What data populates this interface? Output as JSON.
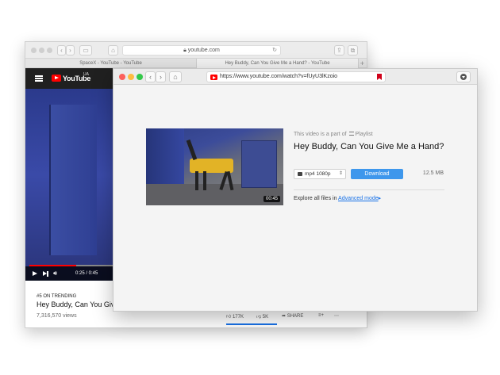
{
  "back_browser": {
    "url": "youtube.com",
    "tabs": [
      {
        "label": "SpaceX - YouTube - YouTube"
      },
      {
        "label": "Hey Buddy, Can You Give Me a Hand? - YouTube"
      }
    ],
    "tab_plus": "+",
    "youtube": {
      "logo_text": "YouTube",
      "region": "UA",
      "time": "0:25 / 0:45",
      "progress": 0.56,
      "trending": "#5 ON TRENDING",
      "title": "Hey Buddy, Can You Give",
      "views": "7,316,570 views",
      "likes": "177K",
      "dislikes": "5K",
      "share": "SHARE"
    }
  },
  "front_browser": {
    "url": "https://www.youtube.com/watch?v=fUyU3lKzoio",
    "playlist_note_prefix": "This video is a part of",
    "playlist_label": "Playlist",
    "video_title": "Hey Buddy, Can You Give Me a Hand?",
    "duration": "00:45",
    "format": "mp4 1080p",
    "download_label": "Download",
    "file_size": "12.5 MB",
    "explore_prefix": "Explore all files in",
    "advanced_mode": "Advanced mode",
    "advanced_arrow": "▸"
  },
  "colors": {
    "accent_blue": "#3e97ec",
    "youtube_red": "#ff0000",
    "traffic_red": "#fc605c",
    "traffic_yellow": "#fdbc40",
    "traffic_green": "#34c84a"
  }
}
